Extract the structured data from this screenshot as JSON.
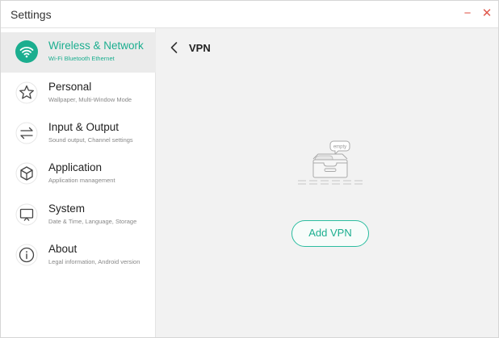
{
  "window": {
    "title": "Settings",
    "minimize_glyph": "−",
    "close_glyph": "✕"
  },
  "sidebar": {
    "items": [
      {
        "label": "Wireless & Network",
        "sub": "Wi-Fi Bluetooth Ethernet",
        "icon": "wifi-icon",
        "active": true
      },
      {
        "label": "Personal",
        "sub": "Wallpaper, Multi-Window Mode",
        "icon": "star-icon",
        "active": false
      },
      {
        "label": "Input & Output",
        "sub": "Sound output, Channel settings",
        "icon": "arrows-swap-icon",
        "active": false
      },
      {
        "label": "Application",
        "sub": "Application management",
        "icon": "cube-icon",
        "active": false
      },
      {
        "label": "System",
        "sub": "Date & Time, Language, Storage",
        "icon": "monitor-icon",
        "active": false
      },
      {
        "label": "About",
        "sub": "Legal information, Android version",
        "icon": "info-icon",
        "active": false
      }
    ]
  },
  "main": {
    "title": "VPN",
    "empty_tag": "empty",
    "add_button": "Add VPN"
  },
  "colors": {
    "accent": "#1bae8f",
    "accent_border": "#2bbda0",
    "active_bg": "#ebebeb",
    "content_bg": "#f2f2f2",
    "window_control": "#e0594d"
  }
}
